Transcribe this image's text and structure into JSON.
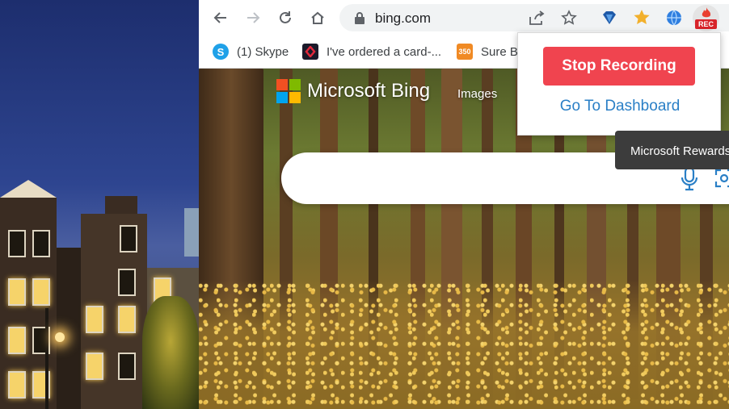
{
  "browser": {
    "url": "bing.com"
  },
  "bookmarks": [
    {
      "label": "(1) Skype"
    },
    {
      "label": "I've ordered a card-..."
    },
    {
      "label": "Sure Be"
    }
  ],
  "page": {
    "logo_text": "Microsoft Bing",
    "nav_images": "Images"
  },
  "popup": {
    "stop_label": "Stop Recording",
    "dashboard_label": "Go To Dashboard"
  },
  "tooltip": {
    "text": "Microsoft Rewards"
  },
  "extensions": {
    "rec_badge": "REC"
  },
  "icons": {
    "bookmark_350": "350"
  },
  "colors": {
    "stop_button": "#f0444f",
    "dashboard_link": "#2a7fc6",
    "tooltip_bg": "#3c3c3c"
  }
}
